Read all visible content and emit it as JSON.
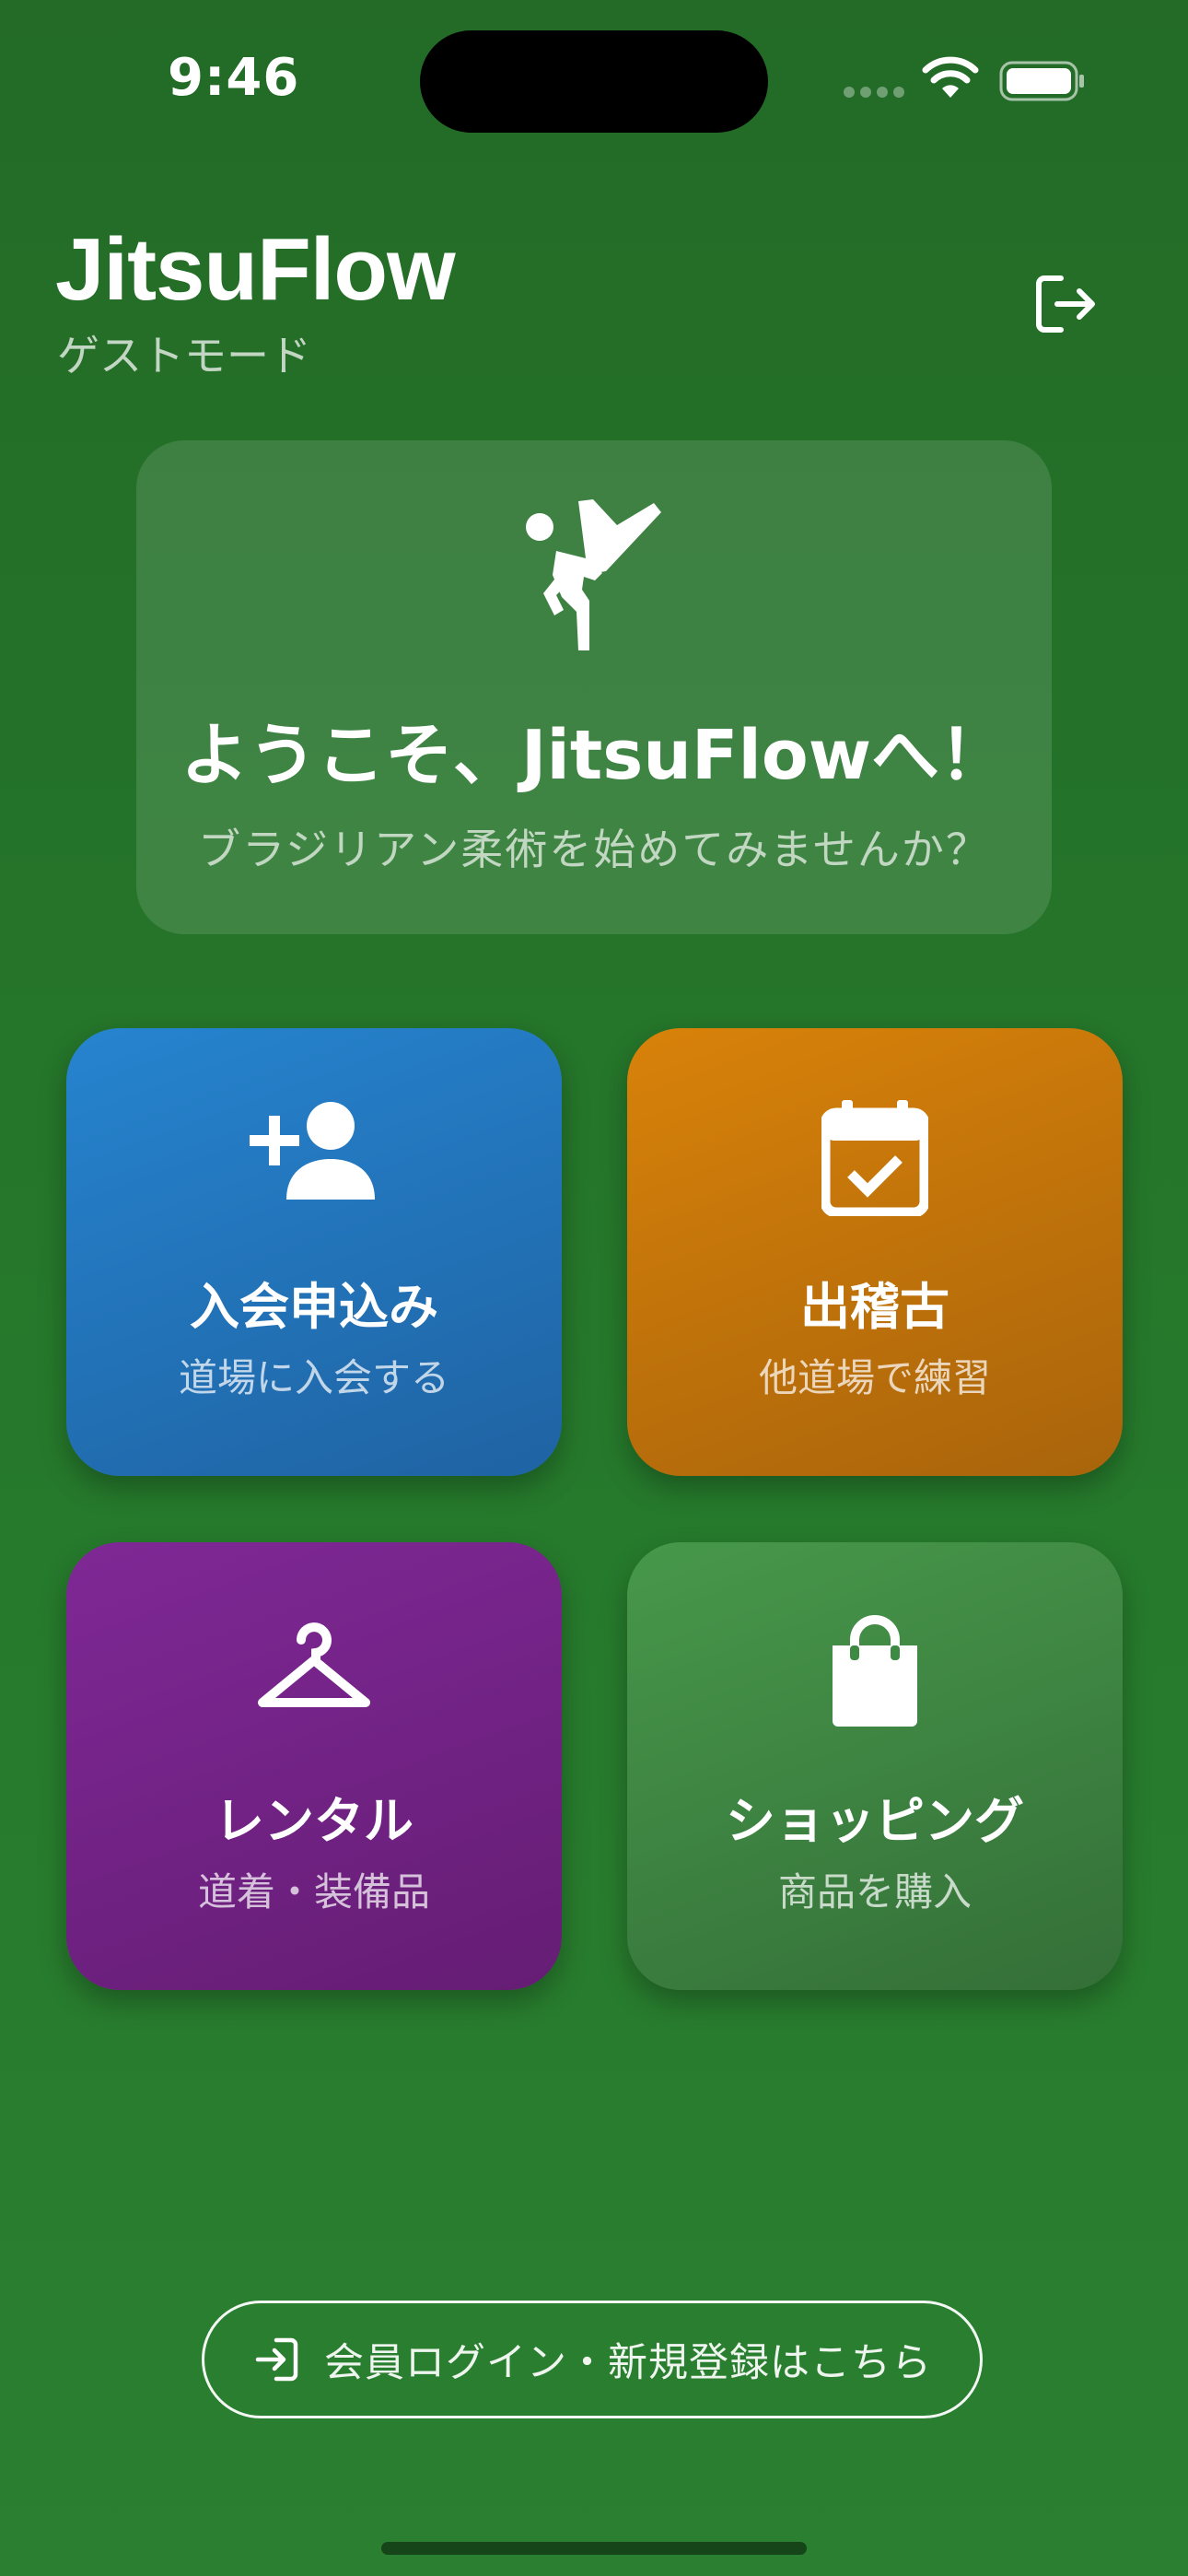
{
  "status_bar": {
    "time": "9:46"
  },
  "header": {
    "title": "JitsuFlow",
    "subtitle": "ゲストモード",
    "logout_icon": "logout-icon"
  },
  "welcome": {
    "icon": "martial-arts-kick-icon",
    "title": "ようこそ、JitsuFlowへ！",
    "subtitle": "ブラジリアン柔術を始めてみませんか？"
  },
  "tiles": [
    {
      "label": "入会申込み",
      "sub": "道場に入会する",
      "icon": "person-add-icon",
      "color": "#2684cf"
    },
    {
      "label": "出稽古",
      "sub": "他道場で練習",
      "icon": "calendar-check-icon",
      "color": "#d8820a"
    },
    {
      "label": "レンタル",
      "sub": "道着・装備品",
      "icon": "hanger-icon",
      "color": "#7f2896"
    },
    {
      "label": "ショッピング",
      "sub": "商品を購入",
      "icon": "shopping-bag-icon",
      "color": "#47984b"
    }
  ],
  "login_button": {
    "label": "会員ログイン・新規登録はこちら",
    "icon": "login-icon"
  },
  "colors": {
    "background": "#267a2c"
  }
}
